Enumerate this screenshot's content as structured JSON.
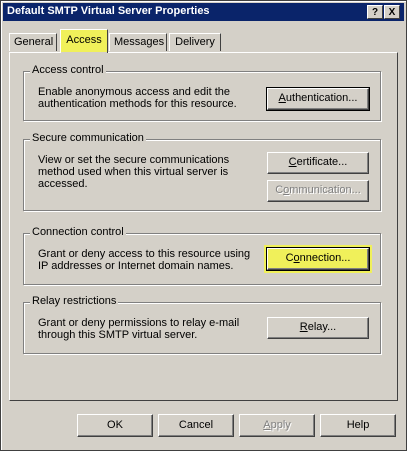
{
  "window": {
    "title": "Default SMTP Virtual Server Properties",
    "help_glyph": "?",
    "close_glyph": "X"
  },
  "tabs": [
    {
      "label": "General",
      "active": false
    },
    {
      "label": "Access",
      "active": true
    },
    {
      "label": "Messages",
      "active": false
    },
    {
      "label": "Delivery",
      "active": false
    }
  ],
  "groups": {
    "access_control": {
      "label": "Access control",
      "text1": "Enable anonymous access and edit the",
      "text2": "authentication methods for this resource.",
      "button_prefix": "",
      "button_ul": "A",
      "button_rest": "uthentication..."
    },
    "secure_communication": {
      "label": "Secure communication",
      "text1": "View or set the secure communications",
      "text2": "method used when this virtual server is",
      "text3": "accessed.",
      "certificate_prefix": "",
      "certificate_ul": "C",
      "certificate_rest": "ertificate...",
      "communication_prefix": "C",
      "communication_ul": "o",
      "communication_rest": "mmunication..."
    },
    "connection_control": {
      "label": "Connection control",
      "text1": "Grant or deny access to this resource using",
      "text2": "IP addresses or Internet domain names.",
      "button_prefix": "C",
      "button_ul": "o",
      "button_rest": "nnection..."
    },
    "relay_restrictions": {
      "label": "Relay restrictions",
      "text1": "Grant or deny permissions to relay e-mail",
      "text2": "through this SMTP virtual server.",
      "button_prefix": "",
      "button_ul": "R",
      "button_rest": "elay..."
    }
  },
  "footer": {
    "ok": "OK",
    "cancel": "Cancel",
    "apply_ul": "A",
    "apply_rest": "pply",
    "help": "Help"
  },
  "colors": {
    "highlight": "#f0f05a",
    "title_bar": "#0a246a",
    "dialog_face": "#d4d0c8"
  }
}
